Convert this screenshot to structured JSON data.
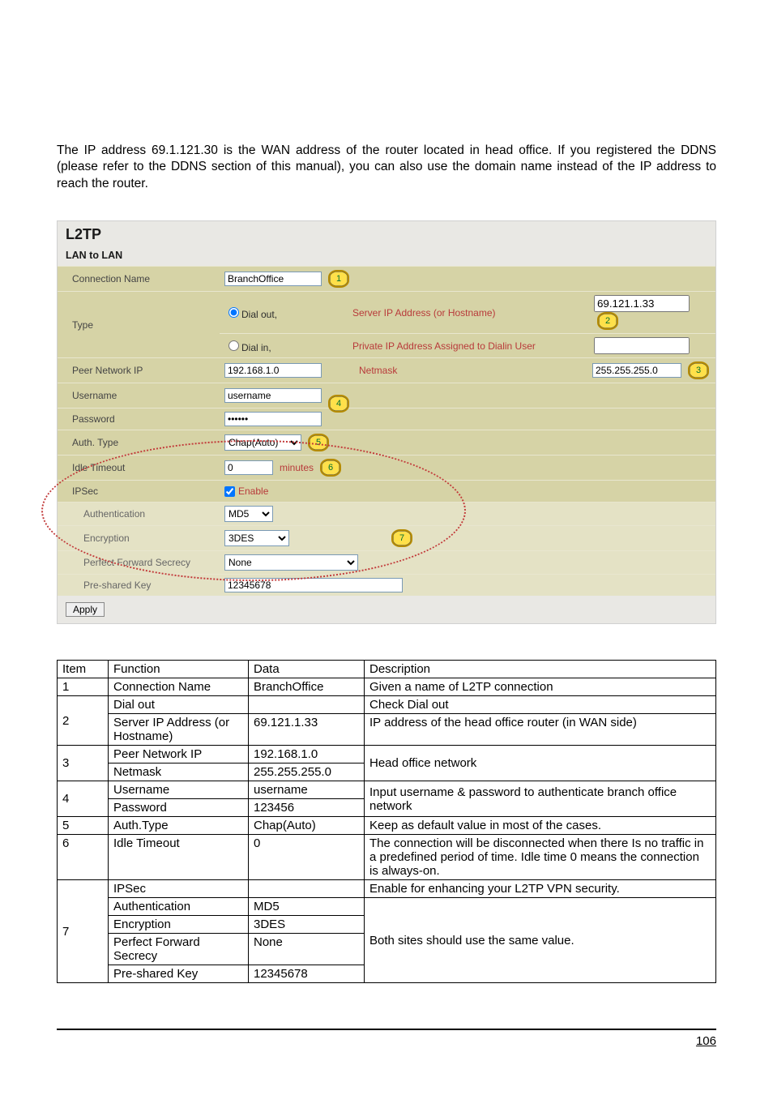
{
  "intro": "The IP address 69.1.121.30 is the WAN address of the router located in head office. If you registered the DDNS (please refer to the DDNS section of this manual), you can also use the domain name instead of the IP address to reach the router.",
  "panel": {
    "title": "L2TP",
    "subtitle": "LAN to LAN",
    "rows": {
      "connection_name_label": "Connection Name",
      "connection_name_value": "BranchOffice",
      "type_label": "Type",
      "dial_out_label": "Dial out,",
      "dial_in_label": "Dial in,",
      "server_ip_label": "Server IP Address (or Hostname)",
      "server_ip_value": "69.121.1.33",
      "private_ip_label": "Private IP Address Assigned to Dialin User",
      "private_ip_value": "",
      "peer_label": "Peer Network IP",
      "peer_value": "192.168.1.0",
      "netmask_label": "Netmask",
      "netmask_value": "255.255.255.0",
      "username_label": "Username",
      "username_value": "username",
      "password_label": "Password",
      "password_value": "••••••",
      "auth_label": "Auth. Type",
      "auth_value": "Chap(Auto)",
      "idle_label": "Idle Timeout",
      "idle_value": "0",
      "idle_unit": "minutes",
      "ipsec_label": "IPSec",
      "ipsec_enable": "Enable",
      "authn_label": "Authentication",
      "authn_value": "MD5",
      "enc_label": "Encryption",
      "enc_value": "3DES",
      "pfs_label": "Perfect Forward Secrecy",
      "pfs_value": "None",
      "psk_label": "Pre-shared Key",
      "psk_value": "12345678",
      "apply": "Apply"
    }
  },
  "callouts": {
    "c1": "1",
    "c2": "2",
    "c3": "3",
    "c4": "4",
    "c5": "5",
    "c6": "6",
    "c7": "7"
  },
  "ref_header": {
    "item": "Item",
    "function": "Function",
    "data": "Data",
    "desc": "Description"
  },
  "ref": [
    {
      "n": "1",
      "f": "Connection Name",
      "d": "BranchOffice",
      "desc": "Given a name of L2TP connection"
    },
    {
      "n": "",
      "f": "Dial out",
      "d": "",
      "desc": "Check Dial out",
      "rs": "2"
    },
    {
      "n": "2",
      "f": "Server IP Address (or Hostname)",
      "d": "69.121.1.33",
      "desc": "IP address of the head office router (in WAN side)"
    },
    {
      "n": "",
      "f": "Peer Network IP",
      "d": "192.168.1.0",
      "desc": "Head office network",
      "rs": "3"
    },
    {
      "n": "3",
      "f": "Netmask",
      "d": "255.255.255.0",
      "desc": ""
    },
    {
      "n": "",
      "f": "Username",
      "d": "username",
      "desc": "Input username & password to authenticate branch office network",
      "rs": "4"
    },
    {
      "n": "4",
      "f": "Password",
      "d": "123456",
      "desc": ""
    },
    {
      "n": "5",
      "f": "Auth.Type",
      "d": "Chap(Auto)",
      "desc": "Keep as default value in most of the cases."
    },
    {
      "n": "6",
      "f": "Idle Timeout",
      "d": "0",
      "desc": "The connection will be disconnected when there Is no traffic in a predefined period of time.  Idle time 0 means the connection is always-on."
    },
    {
      "n": "",
      "f": "IPSec",
      "d": "",
      "desc": "Enable for enhancing your L2TP VPN security."
    },
    {
      "n": "",
      "f": "Authentication",
      "d": "MD5",
      "desc": "Both sites should use the same value.",
      "rs": "7"
    },
    {
      "n": "7",
      "f": "Encryption",
      "d": "3DES",
      "desc": ""
    },
    {
      "n": "",
      "f": "Perfect Forward Secrecy",
      "d": "None",
      "desc": ""
    },
    {
      "n": "",
      "f": "Pre-shared Key",
      "d": "12345678",
      "desc": ""
    }
  ],
  "page_number": "106"
}
